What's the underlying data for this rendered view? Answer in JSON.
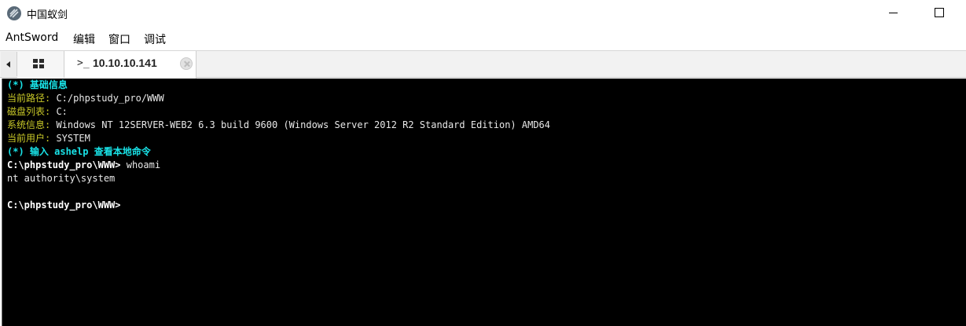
{
  "window": {
    "title": "中国蚁剑",
    "icon": "antsword-logo-icon"
  },
  "menu": {
    "items": [
      "AntSword",
      "编辑",
      "窗口",
      "调试"
    ]
  },
  "tabs": {
    "home_icon": "grid-icon",
    "terminal_prompt_icon": ">_",
    "active_label": "10.10.10.141",
    "close_icon": "close-icon"
  },
  "terminal": {
    "header_basic_info": "(*) 基础信息",
    "current_path_label": "当前路径:",
    "current_path_value": " C:/phpstudy_pro/WWW",
    "disk_list_label": "磁盘列表:",
    "disk_list_value": " C:",
    "system_info_label": "系统信息:",
    "system_info_value": " Windows NT 12SERVER-WEB2 6.3 build 9600 (Windows Server 2012 R2 Standard Edition) AMD64",
    "current_user_label": "当前用户:",
    "current_user_value": " SYSTEM",
    "header_help": "(*) 输入 ashelp 查看本地命令",
    "prompt1": "C:\\phpstudy_pro\\WWW>",
    "command1": " whoami",
    "output1": "nt authority\\system",
    "prompt2": "C:\\phpstudy_pro\\WWW>"
  },
  "colors": {
    "terminal_bg": "#000000",
    "header_cyan": "#19e3e8",
    "label_yellow": "#c8c828",
    "text_white": "#e8e8e8"
  }
}
